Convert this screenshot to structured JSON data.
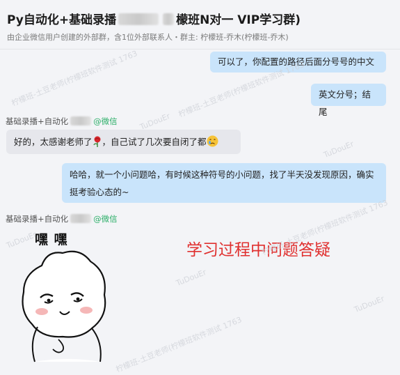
{
  "header": {
    "title_prefix": "Py自动化+基础录播",
    "title_suffix": "檬班N对一 VIP学习群)",
    "subtitle": "由企业微信用户创建的外部群，含1位外部联系人・群主: 柠檬班-乔木(柠檬班-乔木)"
  },
  "messages": [
    {
      "side": "right",
      "text": "可以了，你配置的路径后面分号号的中文"
    },
    {
      "side": "right",
      "text": "英文分号；结尾"
    },
    {
      "side": "left",
      "sender": "基础录播+自动化",
      "sender_tag": "@微信",
      "text": "好的，太感谢老师了",
      "text2": "，自己试了几次要自闭了都"
    },
    {
      "side": "right",
      "text": "哈哈，就一个小问题哈，有时候这种符号的小问题，找了半天没发现原因，确实挺考验心态的~"
    },
    {
      "side": "left",
      "sender": "基础录播+自动化",
      "sender_tag": "@微信",
      "sticker_text": "嘿 嘿"
    }
  ],
  "annotation": "学习过程中问题答疑",
  "watermarks": [
    "柠檬班-土豆老师(柠檬班软件测试 1763",
    "TuDouEr"
  ],
  "colors": {
    "bubble_right": "#c9e4fb",
    "bubble_left": "#e6e7ec",
    "wechat_green": "#2aae67",
    "annotation_red": "#e0302f"
  }
}
